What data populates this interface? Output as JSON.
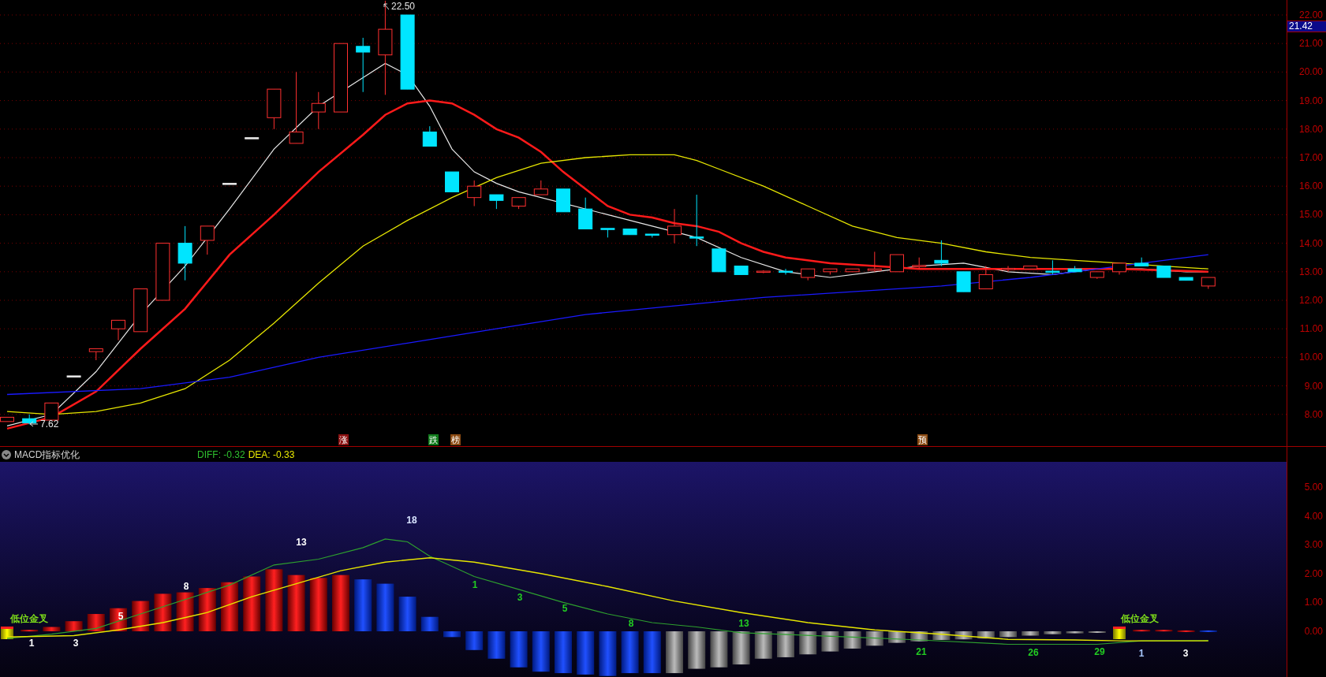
{
  "price_chart": {
    "high_label": "22.50",
    "low_label": "7.62"
  },
  "price_axis": {
    "labels": [
      "22.00",
      "21.00",
      "20.00",
      "19.00",
      "18.00",
      "17.00",
      "16.00",
      "15.00",
      "14.00",
      "13.00",
      "12.00",
      "11.00",
      "10.00",
      "9.00",
      "8.00"
    ],
    "current_price": "21.42"
  },
  "signal_tags": [
    {
      "text": "涨",
      "color": "#8a1010"
    },
    {
      "text": "跌",
      "color": "#0f7a1a"
    },
    {
      "text": "榜",
      "color": "#8a4a12"
    },
    {
      "text": "预",
      "color": "#8a4a12"
    }
  ],
  "indicator": {
    "name": "MACD指标优化",
    "diff": "DIFF: -0.32",
    "dea": "DEA: -0.33"
  },
  "macd_axis": {
    "labels": [
      "5.00",
      "4.00",
      "3.00",
      "2.00",
      "1.00",
      "0.00"
    ]
  },
  "macd_labels": [
    {
      "text": "低位金叉",
      "color": "#7fe01a"
    },
    {
      "text": "1",
      "color": "#ffffff"
    },
    {
      "text": "3",
      "color": "#ffffff"
    },
    {
      "text": "5",
      "color": "#ffffff"
    },
    {
      "text": "8",
      "color": "#ffffff"
    },
    {
      "text": "13",
      "color": "#ffffff"
    },
    {
      "text": "18",
      "color": "#d8e4ff"
    },
    {
      "text": "1",
      "color": "#22cc22"
    },
    {
      "text": "3",
      "color": "#22cc22"
    },
    {
      "text": "5",
      "color": "#22cc22"
    },
    {
      "text": "8",
      "color": "#22cc22"
    },
    {
      "text": "13",
      "color": "#22cc22"
    },
    {
      "text": "21",
      "color": "#22cc22"
    },
    {
      "text": "26",
      "color": "#22cc22"
    },
    {
      "text": "29",
      "color": "#22cc22"
    },
    {
      "text": "低位金叉",
      "color": "#7fe01a"
    },
    {
      "text": "1",
      "color": "#a8c8ff"
    },
    {
      "text": "3",
      "color": "#ffffff"
    }
  ]
}
